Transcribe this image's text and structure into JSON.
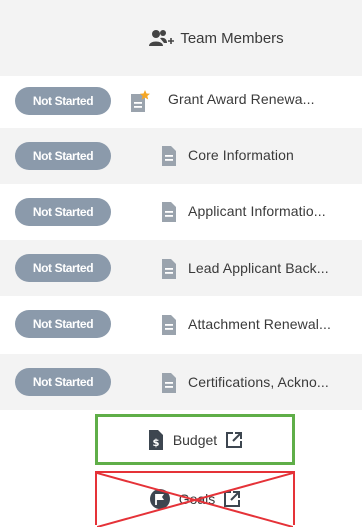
{
  "header": {
    "icon": "team-members-icon",
    "label": "Team Members"
  },
  "items": [
    {
      "status": "Not Started",
      "label": "Grant Award Renewa...",
      "icon": "form-star-icon"
    },
    {
      "status": "Not Started",
      "label": "Core Information",
      "icon": "document-icon"
    },
    {
      "status": "Not Started",
      "label": "Applicant Informatio...",
      "icon": "document-icon"
    },
    {
      "status": "Not Started",
      "label": "Lead Applicant Back...",
      "icon": "document-icon"
    },
    {
      "status": "Not Started",
      "label": "Attachment Renewal...",
      "icon": "document-icon"
    },
    {
      "status": "Not Started",
      "label": "Certifications, Ackno...",
      "icon": "document-icon"
    }
  ],
  "budget": {
    "label": "Budget",
    "icon": "dollar-document-icon",
    "link_icon": "external-link-icon",
    "highlight_color": "#5fae48"
  },
  "goals": {
    "label": "Goals",
    "icon": "flag-circle-icon",
    "link_icon": "external-link-icon",
    "cross_out_color": "#e53238"
  },
  "colors": {
    "badge": "#8b9aab",
    "alt_row": "#f3f3f3",
    "icon": "#9aa3ad",
    "star": "#f5a623"
  }
}
